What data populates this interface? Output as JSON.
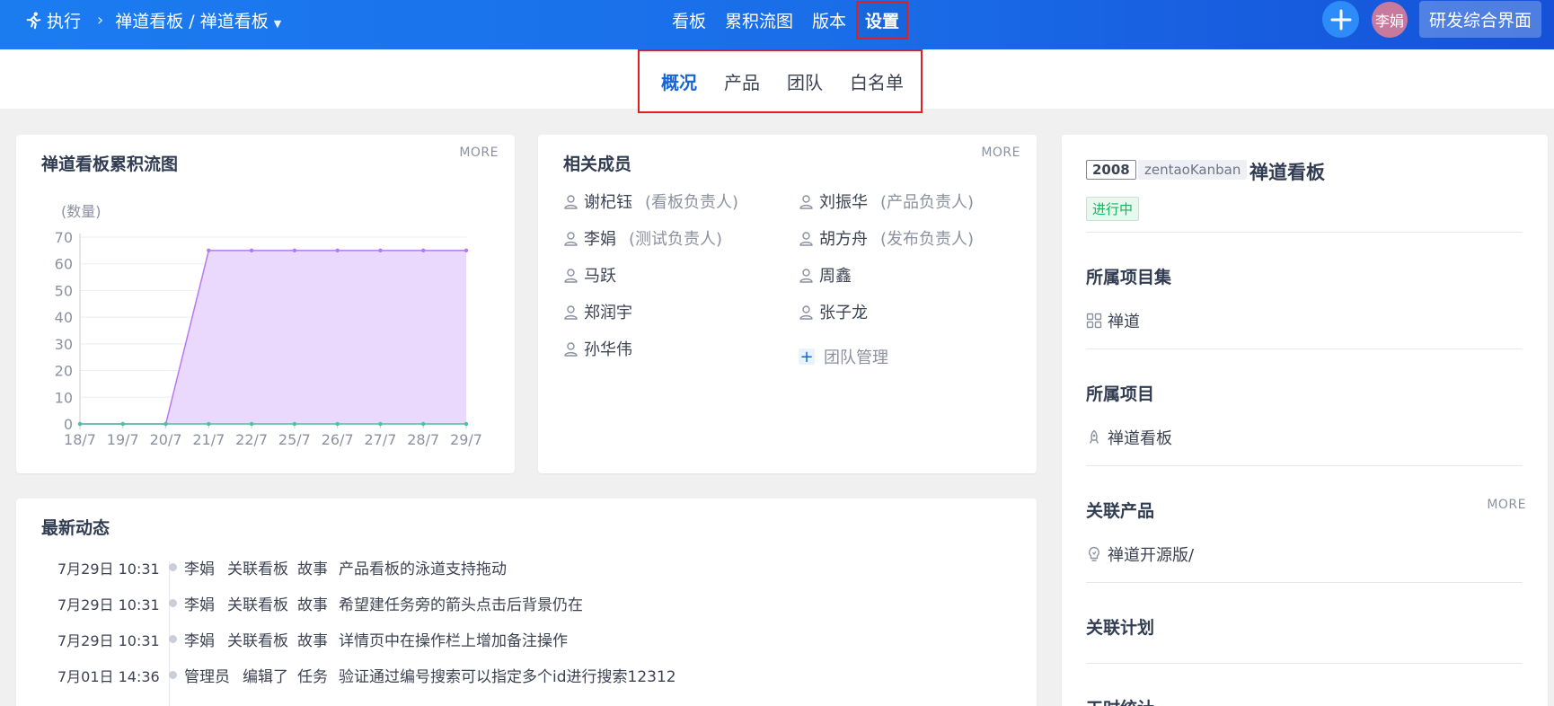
{
  "topbar": {
    "breadcrumb_root": "执行",
    "breadcrumb_current": "禅道看板 / 禅道看板",
    "nav": [
      "看板",
      "累积流图",
      "版本",
      "设置"
    ],
    "active_nav": "设置",
    "avatar_text": "李娟",
    "app_switch": "研发综合界面"
  },
  "subnav": {
    "items": [
      "概况",
      "产品",
      "团队",
      "白名单"
    ],
    "active": "概况"
  },
  "cfd_card": {
    "title": "禅道看板累积流图",
    "more": "MORE"
  },
  "chart_data": {
    "type": "area",
    "ylabel": "(数量)",
    "ylim": [
      0,
      70
    ],
    "yticks": [
      0,
      10,
      20,
      30,
      40,
      50,
      60,
      70
    ],
    "categories": [
      "18/7",
      "19/7",
      "20/7",
      "21/7",
      "22/7",
      "25/7",
      "26/7",
      "27/7",
      "28/7",
      "29/7"
    ],
    "series": [
      {
        "values": [
          0,
          0,
          0,
          65,
          65,
          65,
          65,
          65,
          65,
          65
        ],
        "color": "#b679f5",
        "fill": "#ead9fc"
      },
      {
        "values": [
          0,
          0,
          0,
          0,
          0,
          0,
          0,
          0,
          0,
          0
        ],
        "color": "#4cc0a0"
      }
    ]
  },
  "members_card": {
    "title": "相关成员",
    "more": "MORE",
    "left": [
      {
        "name": "谢杞钰",
        "role": "(看板负责人)"
      },
      {
        "name": "李娟",
        "role": "(测试负责人)"
      },
      {
        "name": "马跃",
        "role": ""
      },
      {
        "name": "郑润宇",
        "role": ""
      },
      {
        "name": "孙华伟",
        "role": ""
      }
    ],
    "right": [
      {
        "name": "刘振华",
        "role": "(产品负责人)"
      },
      {
        "name": "胡方舟",
        "role": "(发布负责人)"
      },
      {
        "name": "周鑫",
        "role": ""
      },
      {
        "name": "张子龙",
        "role": ""
      }
    ],
    "team_manage": "团队管理"
  },
  "dynamics_card": {
    "title": "最新动态",
    "rows": [
      {
        "time": "7月29日 10:31",
        "who": "李娟",
        "action": "关联看板",
        "type": "故事",
        "title": "产品看板的泳道支持拖动"
      },
      {
        "time": "7月29日 10:31",
        "who": "李娟",
        "action": "关联看板",
        "type": "故事",
        "title": "希望建任务旁的箭头点击后背景仍在"
      },
      {
        "time": "7月29日 10:31",
        "who": "李娟",
        "action": "关联看板",
        "type": "故事",
        "title": "详情页中在操作栏上增加备注操作"
      },
      {
        "time": "7月01日 14:36",
        "who": "管理员",
        "action": "编辑了",
        "type": "任务",
        "title": "验证通过编号搜索可以指定多个id进行搜索12312"
      }
    ]
  },
  "right_panel": {
    "id": "2008",
    "code": "zentaoKanban",
    "name": "禅道看板",
    "status": "进行中",
    "program_head": "所属项目集",
    "program": "禅道",
    "project_head": "所属项目",
    "project": "禅道看板",
    "product_head": "关联产品",
    "product_more": "MORE",
    "product": "禅道开源版/",
    "plan_head": "关联计划",
    "effort_head": "工时统计"
  }
}
